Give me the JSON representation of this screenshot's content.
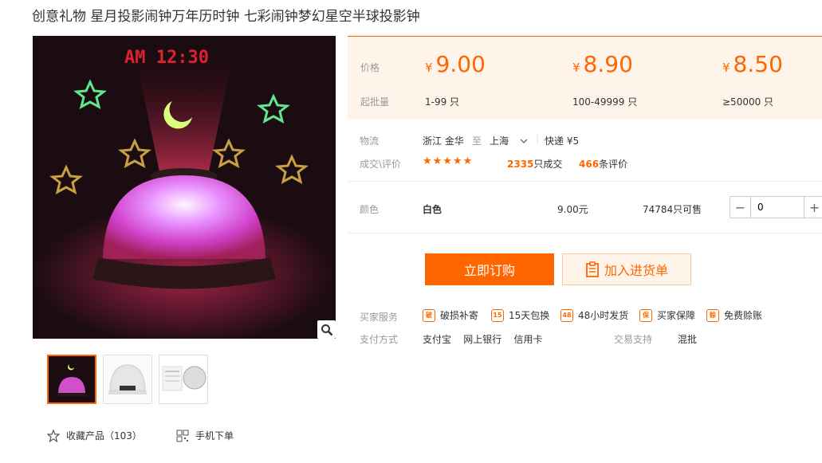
{
  "product": {
    "title": "创意礼物 星月投影闹钟万年历时钟 七彩闹钟梦幻星空半球投影钟",
    "main_image_clock_text": "AM 12:30"
  },
  "pricing": {
    "price_label": "价格",
    "qty_label": "起批量",
    "currency": "¥",
    "tiers": [
      {
        "price": "9.00",
        "range": "1-99 只"
      },
      {
        "price": "8.90",
        "range": "100-49999 只"
      },
      {
        "price": "8.50",
        "range": "≥50000 只"
      }
    ]
  },
  "logistics": {
    "label": "物流",
    "origin": "浙江 金华",
    "to": "至",
    "dest": "上海",
    "shipping": "快递 ¥5"
  },
  "deals": {
    "label": "成交\\评价",
    "stars": "★★★★★",
    "sold_count": "2335",
    "sold_suffix": "只成交",
    "review_count": "466",
    "review_suffix": "条评价"
  },
  "variant": {
    "label": "颜色",
    "color": "白色",
    "price": "9.00元",
    "stock": "74784只可售",
    "quantity": "0",
    "minus": "−",
    "plus": "+"
  },
  "actions": {
    "buy_now": "立即订购",
    "add_to_list": "加入进货单"
  },
  "services": {
    "label": "买家服务",
    "items": [
      {
        "icon": "破",
        "label": "破损补寄"
      },
      {
        "icon": "15",
        "label": "15天包换"
      },
      {
        "icon": "48",
        "label": "48小时发货"
      },
      {
        "icon": "保",
        "label": "买家保障"
      },
      {
        "icon": "赊",
        "label": "免费赊账"
      }
    ]
  },
  "payment": {
    "label": "支付方式",
    "methods": "支付宝    网上银行    信用卡"
  },
  "trade_support": {
    "label": "交易支持",
    "value": "混批"
  },
  "footer": {
    "favorite": "收藏产品（103）",
    "mobile_order": "手机下单"
  },
  "colors": {
    "accent": "#ff6600",
    "price_bg": "#fff4ea"
  }
}
